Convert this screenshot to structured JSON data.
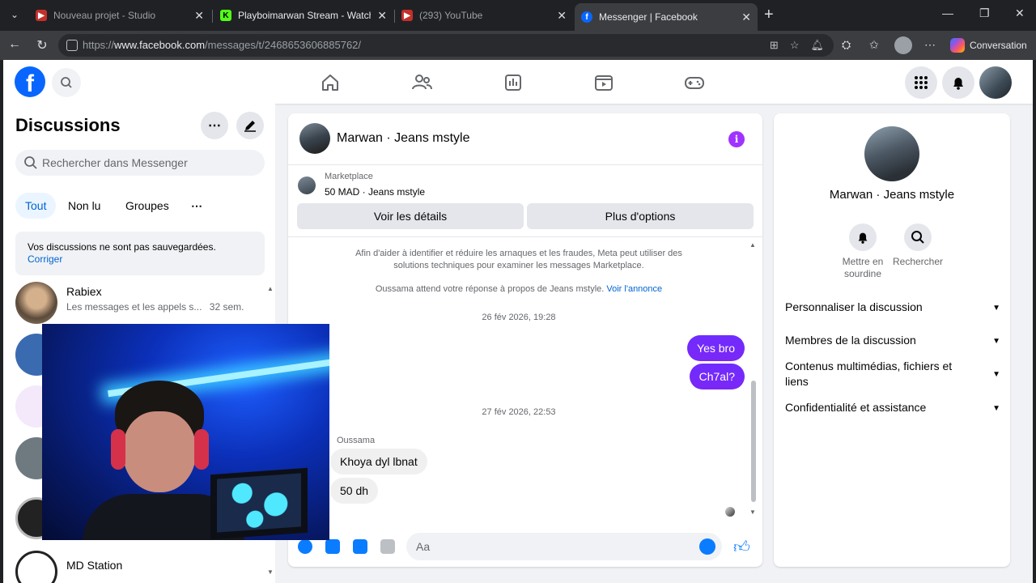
{
  "browser": {
    "tabs": [
      {
        "title": "Nouveau projet - Studio",
        "active": false
      },
      {
        "title": "Playboimarwan Stream - Watch Li...",
        "active": false
      },
      {
        "title": "(293) YouTube",
        "active": false
      },
      {
        "title": "Messenger | Facebook",
        "active": true
      }
    ],
    "url": {
      "prefix": "https://",
      "domain": "www.facebook.com",
      "path": "/messages/t/2468653606885762/"
    },
    "conversation_button": "Conversation"
  },
  "sidebar": {
    "title": "Discussions",
    "search_placeholder": "Rechercher dans Messenger",
    "filters": [
      "Tout",
      "Non lu",
      "Groupes"
    ],
    "notice_text": "Vos discussions ne sont pas sauvegardées.",
    "notice_link": "Corriger",
    "conversations": [
      {
        "name": "Rabiex",
        "preview": "Les messages et les appels s...",
        "time": "32 sem."
      },
      {
        "name": "MD Station",
        "preview": "",
        "time": ""
      }
    ]
  },
  "chat": {
    "contact": "Marwan · Jeans mstyle",
    "marketplace_label": "Marketplace",
    "listing": "50 MAD · Jeans mstyle",
    "details_button": "Voir les détails",
    "options_button": "Plus d'options",
    "safety_text": "Afin d'aider à identifier et réduire les arnaques et les fraudes, Meta peut utiliser des solutions techniques pour examiner les messages Marketplace.",
    "awaiting_text": "Oussama attend votre réponse à propos de Jeans mstyle.",
    "awaiting_link": "Voir l'annonce",
    "timestamp1": "26 fév 2026, 19:28",
    "outgoing": [
      "Yes bro",
      "Ch7al?"
    ],
    "timestamp2": "27 fév 2026, 22:53",
    "sender": "Oussama",
    "incoming": [
      "Khoya dyl lbnat",
      "50 dh"
    ],
    "composer_placeholder": "Aa"
  },
  "info_panel": {
    "name": "Marwan · Jeans mstyle",
    "actions": [
      {
        "icon": "bell-icon",
        "label": "Mettre en sourdine"
      },
      {
        "icon": "search-icon",
        "label": "Rechercher"
      }
    ],
    "sections": [
      "Personnaliser la discussion",
      "Membres de la discussion",
      "Contenus multimédias, fichiers et liens",
      "Confidentialité et assistance"
    ]
  },
  "colors": {
    "brand": "#0866ff",
    "bubble_out": "#7a1fff",
    "accent_link": "#0064d1"
  }
}
